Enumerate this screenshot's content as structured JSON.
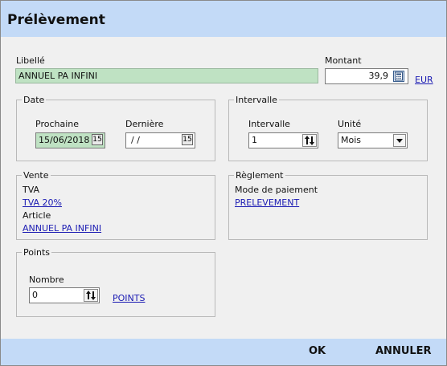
{
  "window": {
    "title": "Prélèvement"
  },
  "libelle": {
    "label": "Libellé",
    "value": "ANNUEL PA INFINI"
  },
  "montant": {
    "label": "Montant",
    "value": "39,9",
    "currency": "EUR",
    "calc_icon": "calculator-icon"
  },
  "date": {
    "legend": "Date",
    "prochaine_label": "Prochaine",
    "prochaine_value": "15/06/2018",
    "derniere_label": "Dernière",
    "derniere_value": "/ /",
    "calendar_icon": "calendar-icon"
  },
  "intervalle": {
    "legend": "Intervalle",
    "label": "Intervalle",
    "value": "1",
    "unite_label": "Unité",
    "unite_value": "Mois",
    "spin_icon": "spin-arrows-icon"
  },
  "vente": {
    "legend": "Vente",
    "tva_label": "TVA",
    "tva_link": "TVA 20%",
    "article_label": "Article",
    "article_link": "ANNUEL PA INFINI"
  },
  "reglement": {
    "legend": "Règlement",
    "mode_label": "Mode de paiement",
    "mode_link": "PRELEVEMENT"
  },
  "points": {
    "legend": "Points",
    "nombre_label": "Nombre",
    "nombre_value": "0",
    "link": "POINTS"
  },
  "footer": {
    "ok": "OK",
    "cancel": "ANNULER"
  },
  "colors": {
    "title_bar": "#c3daf7",
    "libelle_field": "#bfe2c3",
    "date_field": "#bfe2c3",
    "link": "#1b1bb3",
    "window_bg": "#f0f0f0"
  }
}
